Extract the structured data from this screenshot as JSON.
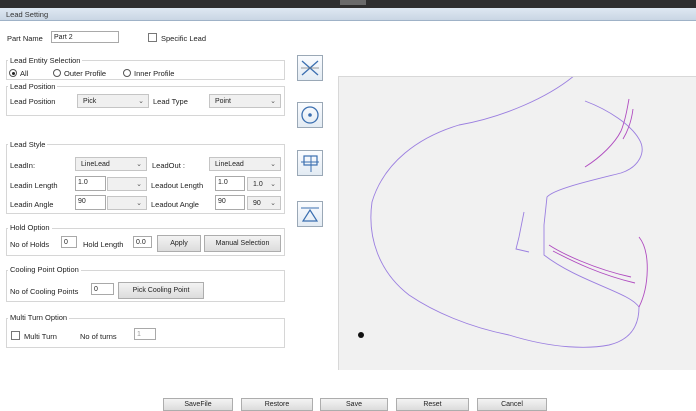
{
  "window": {
    "title": "Lead Setting"
  },
  "part": {
    "label": "Part Name",
    "value": "Part 2",
    "specific_lead_label": "Specific Lead"
  },
  "entity": {
    "title": "Lead Entity Selection",
    "options": [
      "All",
      "Outer Profile",
      "Inner Profile"
    ],
    "selected": "All"
  },
  "position": {
    "title": "Lead Position",
    "pos_label": "Lead Position",
    "pos_value": "Pick",
    "type_label": "Lead Type",
    "type_value": "Point"
  },
  "style": {
    "title": "Lead Style",
    "leadin_label": "LeadIn:",
    "leadin_value": "LineLead",
    "leadout_label": "LeadOut :",
    "leadout_value": "LineLead",
    "leadin_length_label": "Leadin Length",
    "leadin_length_value": "1.0",
    "leadout_length_label": "Leadout Length",
    "leadout_length_value": "1.0",
    "leadout_length_combo": "1.0",
    "leadin_angle_label": "Leadin Angle",
    "leadin_angle_value": "90",
    "leadout_angle_label": "Leadout Angle",
    "leadout_angle_value": "90",
    "leadout_angle_combo": "90"
  },
  "hold": {
    "title": "Hold Option",
    "holds_label": "No of Holds",
    "holds_value": "0",
    "length_label": "Hold Length",
    "length_value": "0.0",
    "apply_label": "Apply",
    "manual_label": "Manual Selection"
  },
  "cooling": {
    "title": "Cooling Point Option",
    "count_label": "No of Cooling Points",
    "count_value": "0",
    "pick_label": "Pick Cooling Point"
  },
  "multiturn": {
    "title": "Multi Turn Option",
    "check_label": "Multi Turn",
    "turns_label": "No of turns",
    "turns_value": "1"
  },
  "footer": {
    "save_file": "SaveFile",
    "restore": "Restore",
    "save": "Save",
    "reset": "Reset",
    "cancel": "Cancel"
  },
  "colors": {
    "profile": "#9b7fe0",
    "inner": "#b04cc0",
    "accent": "#3b7fc4"
  },
  "tools": [
    "intersect-tool-icon",
    "circle-target-icon",
    "lead-insert-icon",
    "triangle-baseline-icon"
  ]
}
